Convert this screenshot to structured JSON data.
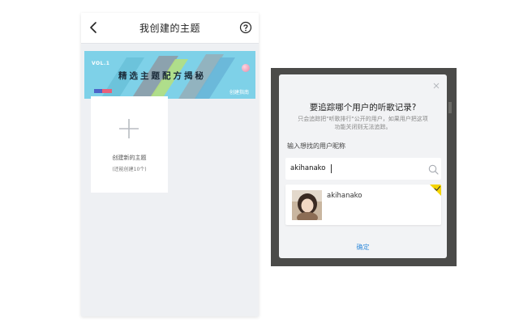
{
  "left_screen": {
    "header": {
      "title": "我创建的主题",
      "back_icon": "chevron-left-icon",
      "help_icon": "question-circle-icon"
    },
    "banner": {
      "vol": "VOL.1",
      "title": "精选主题配方揭秘",
      "link": "创建指南",
      "color": "#7ed1e8"
    },
    "create_card": {
      "icon": "plus-icon",
      "label": "创建新的主题",
      "sublabel": "(还能创建10个)"
    }
  },
  "dialog": {
    "close_icon": "close-icon",
    "title": "要追踪哪个用户的听歌记录?",
    "description": "只会追踪把\"听歌排行\"公开的用户，如果用户把这项功能关闭则无法追踪。",
    "input_label": "输入想找的用户昵称",
    "search": {
      "value": "akihanako",
      "icon": "search-icon"
    },
    "result": {
      "name": "akihanako",
      "selected": true,
      "check_color": "#f5d400"
    },
    "confirm_label": "确定",
    "accent": "#3a8fdc"
  }
}
